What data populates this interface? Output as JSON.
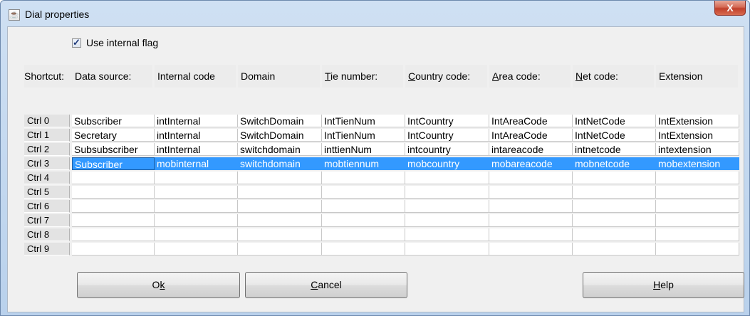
{
  "window": {
    "title": "Dial properties",
    "close_label": "X",
    "app_icon": "java-cup-icon"
  },
  "options": {
    "use_internal_flag_label": "Use internal flag",
    "use_internal_flag_checked": true
  },
  "table": {
    "columns": [
      "Shortcut:",
      "Data source:",
      "Internal code",
      "Domain",
      "Tie number:",
      "Country code:",
      "Area code:",
      "Net code:",
      "Extension"
    ],
    "rows": [
      {
        "shortcut": "Ctrl 0",
        "cells": [
          "Subscriber",
          "intInternal",
          "SwitchDomain",
          "IntTienNum",
          "IntCountry",
          "IntAreaCode",
          "IntNetCode",
          "IntExtension"
        ]
      },
      {
        "shortcut": "Ctrl 1",
        "cells": [
          "Secretary",
          "intInternal",
          "SwitchDomain",
          "IntTienNum",
          "IntCountry",
          "IntAreaCode",
          "IntNetCode",
          "IntExtension"
        ]
      },
      {
        "shortcut": "Ctrl 2",
        "cells": [
          "Subsubscriber",
          "intInternal",
          "switchdomain",
          "inttienNum",
          "intcountry",
          "intareacode",
          "intnetcode",
          "intextension"
        ]
      },
      {
        "shortcut": "Ctrl 3",
        "cells": [
          "Subscriber",
          "mobinternal",
          "switchdomain",
          "mobtiennum",
          "mobcountry",
          "mobareacode",
          "mobnetcode",
          "mobextension"
        ],
        "selected": true
      },
      {
        "shortcut": "Ctrl 4",
        "cells": [
          "",
          "",
          "",
          "",
          "",
          "",
          "",
          ""
        ]
      },
      {
        "shortcut": "Ctrl 5",
        "cells": [
          "",
          "",
          "",
          "",
          "",
          "",
          "",
          ""
        ]
      },
      {
        "shortcut": "Ctrl 6",
        "cells": [
          "",
          "",
          "",
          "",
          "",
          "",
          "",
          ""
        ]
      },
      {
        "shortcut": "Ctrl 7",
        "cells": [
          "",
          "",
          "",
          "",
          "",
          "",
          "",
          ""
        ]
      },
      {
        "shortcut": "Ctrl 8",
        "cells": [
          "",
          "",
          "",
          "",
          "",
          "",
          "",
          ""
        ]
      },
      {
        "shortcut": "Ctrl 9",
        "cells": [
          "",
          "",
          "",
          "",
          "",
          "",
          "",
          ""
        ]
      }
    ]
  },
  "buttons": {
    "ok": {
      "pre": "O",
      "mnemonic": "k",
      "post": ""
    },
    "cancel": {
      "pre": "",
      "mnemonic": "C",
      "post": "ancel"
    },
    "help": {
      "pre": "",
      "mnemonic": "H",
      "post": "elp"
    }
  },
  "colors": {
    "selection": "#3399ff",
    "selection_text": "#ffffff"
  }
}
